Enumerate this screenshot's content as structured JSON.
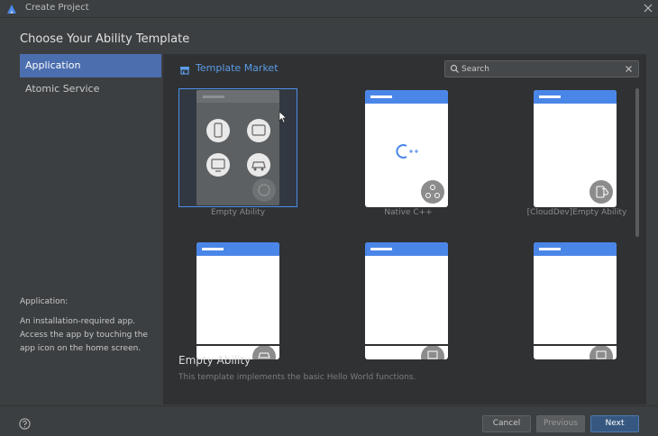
{
  "window": {
    "title": "Create Project",
    "logo_icon": "deveco-logo-icon",
    "close_icon": "close-icon"
  },
  "heading": "Choose Your Ability Template",
  "sidebar": {
    "items": [
      {
        "label": "Application",
        "selected": true
      },
      {
        "label": "Atomic Service",
        "selected": false
      }
    ]
  },
  "description": {
    "title": "Application:",
    "body": "An installation-required app. Access the app by touching the app icon on the home screen."
  },
  "market": {
    "label": "Template Market",
    "icon": "store-icon"
  },
  "search": {
    "placeholder": "Search",
    "value": ""
  },
  "templates": [
    {
      "label": "Empty Ability",
      "selected": true
    },
    {
      "label": "Native C++",
      "badge": "cpp-icon"
    },
    {
      "label": "[CloudDev]Empty Ability",
      "badge": "cloud-dev-icon"
    },
    {
      "label": ""
    },
    {
      "label": ""
    },
    {
      "label": ""
    }
  ],
  "detail": {
    "title": "Empty Ability",
    "description": "This template implements the basic Hello World functions."
  },
  "footer": {
    "help_icon": "help-icon",
    "cancel_label": "Cancel",
    "previous_label": "Previous",
    "next_label": "Next"
  },
  "colors": {
    "accent": "#4b6eaf",
    "link": "#5c9ce6",
    "card_bar": "#4a86e8",
    "background": "#3c3f41",
    "panel": "#2f3133"
  }
}
